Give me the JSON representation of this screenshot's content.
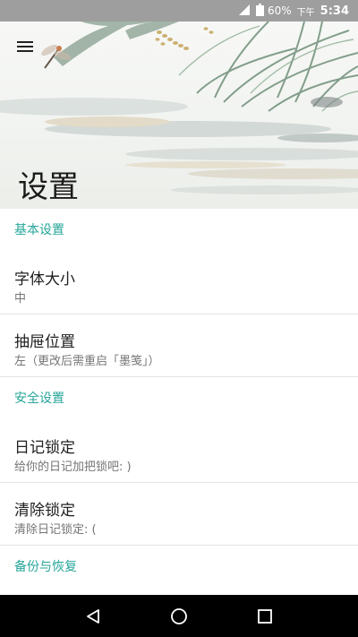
{
  "status_bar": {
    "battery_percent": "60%",
    "period": "下午",
    "time": "5:34",
    "icons": [
      "signal-icon",
      "battery-icon"
    ]
  },
  "header": {
    "title": "设置",
    "menu_icon": "hamburger-menu-icon"
  },
  "sections": [
    {
      "header": "基本设置",
      "items": [
        {
          "title": "字体大小",
          "summary": "中"
        },
        {
          "title": "抽屉位置",
          "summary": "左（更改后需重启「墨笺」）"
        }
      ]
    },
    {
      "header": "安全设置",
      "items": [
        {
          "title": "日记锁定",
          "summary": "给你的日记加把锁吧: )"
        },
        {
          "title": "清除锁定",
          "summary": "清除日记锁定: ("
        }
      ]
    },
    {
      "header": "备份与恢复",
      "items": []
    }
  ],
  "nav_bar": {
    "icons": [
      "back-icon",
      "home-icon",
      "recents-icon"
    ]
  },
  "colors": {
    "accent": "#26a69a",
    "status_bar": "#9e9e9e",
    "nav_bar": "#000000"
  }
}
